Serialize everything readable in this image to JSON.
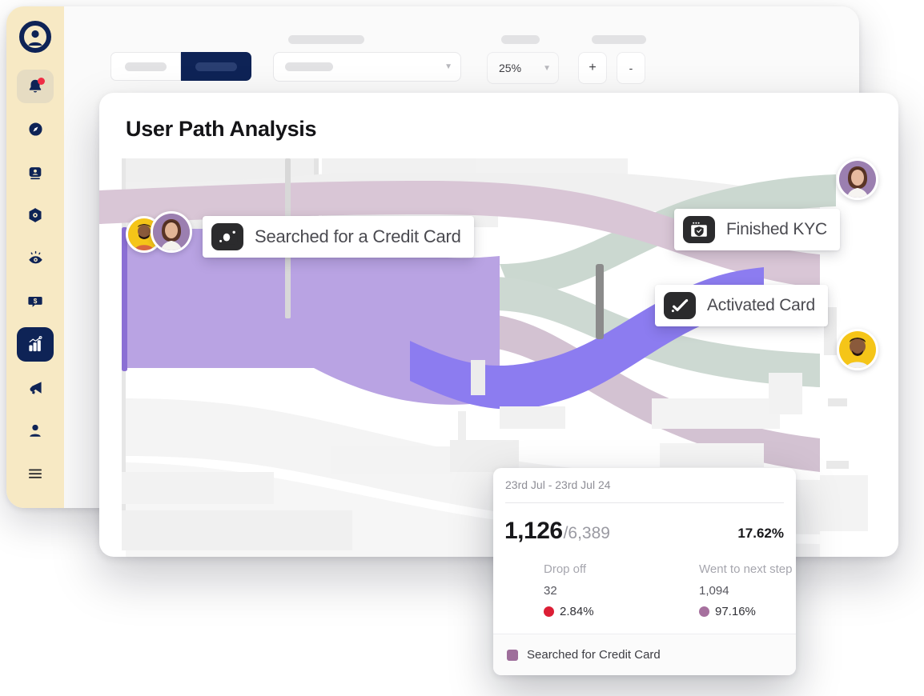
{
  "app": {
    "sidebar": {
      "logo_icon": "user-circle-logo",
      "items": [
        {
          "icon": "bell-notification-icon",
          "name": "notifications",
          "state": "highlighted",
          "badge": true
        },
        {
          "icon": "compass-icon",
          "name": "explore",
          "state": "normal",
          "badge": false
        },
        {
          "icon": "id-badge-icon",
          "name": "identity",
          "state": "normal",
          "badge": false
        },
        {
          "icon": "cube-network-icon",
          "name": "integrations",
          "state": "normal",
          "badge": false
        },
        {
          "icon": "eye-insights-icon",
          "name": "insights",
          "state": "normal",
          "badge": false
        },
        {
          "icon": "dollar-chat-icon",
          "name": "revenue-chat",
          "state": "normal",
          "badge": false
        },
        {
          "icon": "bar-chart-analytics-icon",
          "name": "analytics",
          "state": "active",
          "badge": false
        },
        {
          "icon": "megaphone-icon",
          "name": "campaigns",
          "state": "normal",
          "badge": false
        },
        {
          "icon": "person-icon",
          "name": "profile",
          "state": "normal",
          "badge": false
        }
      ],
      "bottom": {
        "icon": "hamburger-menu-icon",
        "name": "menu"
      }
    },
    "toolbar": {
      "segmented": {
        "left_label": "",
        "right_label": "",
        "selected": "right"
      },
      "select": {
        "label": "",
        "value": "",
        "caret_icon": "chevron-down-icon"
      },
      "zoom": {
        "label": "",
        "value": "25%",
        "caret_icon": "chevron-down-icon"
      },
      "stepper": {
        "label": "",
        "increase": "+",
        "decrease": "-"
      }
    }
  },
  "card": {
    "title": "User Path Analysis",
    "nodes": [
      {
        "id": "searched",
        "label": "Searched for a Credit Card",
        "icon": "credit-card-dark-icon"
      },
      {
        "id": "kyc",
        "label": "Finished KYC",
        "icon": "browser-shield-check-icon"
      },
      {
        "id": "activated",
        "label": "Activated Card",
        "icon": "check-square-icon"
      }
    ],
    "avatars": [
      {
        "name": "avatar-user-1",
        "bg": "#F5C518",
        "side": "left"
      },
      {
        "name": "avatar-user-2",
        "bg": "#9B7FB0",
        "side": "left"
      },
      {
        "name": "avatar-user-3",
        "bg": "#9B7FB0",
        "side": "right-top"
      },
      {
        "name": "avatar-user-4",
        "bg": "#F5C518",
        "side": "right-bottom"
      }
    ]
  },
  "tooltip": {
    "date_range": "23rd Jul - 23rd Jul 24",
    "value": "1,126",
    "total": "/6,389",
    "percent": "17.62%",
    "dropoff": {
      "label": "Drop off",
      "value": "32",
      "percent": "2.84%",
      "color": "#DC1E35"
    },
    "next_step": {
      "label": "Went to next step",
      "value": "1,094",
      "percent": "97.16%",
      "color": "#A6709E"
    },
    "legend": {
      "label": "Searched for Credit Card",
      "color": "#9E6E9B"
    }
  },
  "colors": {
    "sidebar_bg": "#F7E9C4",
    "navy": "#0E2356",
    "panel_bg": "#FAFAFA",
    "card_bg": "#FFFFFF",
    "flow_purple_light": "#B9A3E3",
    "flow_purple": "#8C7CF0",
    "flow_mauve": "#D5C2D2",
    "flow_sage": "#C9D6CE",
    "flow_grey": "#EFEFEF",
    "node_grey": "#8B8B8B",
    "accent_red": "#DC1E35",
    "accent_purple": "#A6709E"
  },
  "chart_data": {
    "type": "sankey",
    "title": "User Path Analysis",
    "nodes": [
      "Searched for a Credit Card",
      "Finished KYC",
      "Activated Card"
    ],
    "links": [
      {
        "source": "Searched for a Credit Card",
        "target": "Finished KYC",
        "value": 1094,
        "percent": 97.16,
        "color": "#B9A3E3"
      },
      {
        "source": "Searched for a Credit Card",
        "target": "Drop off",
        "value": 32,
        "percent": 2.84,
        "color": "#DC1E35"
      }
    ],
    "focus_step": {
      "label": "Searched for Credit Card",
      "value": 1126,
      "total": 6389,
      "percent": 17.62
    },
    "date_range": "23rd Jul - 23rd Jul 24",
    "legend_position": "bottom"
  }
}
